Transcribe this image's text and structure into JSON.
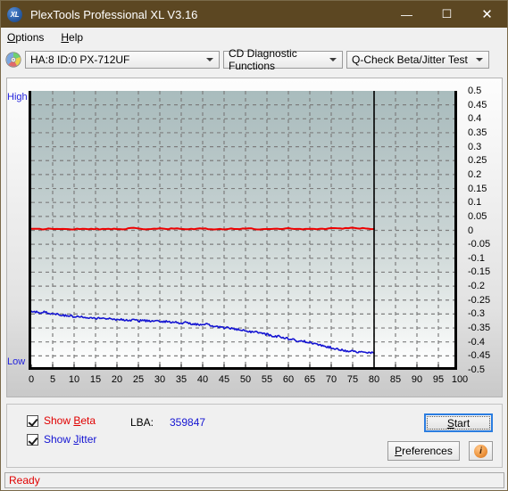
{
  "window": {
    "title": "PlexTools Professional XL V3.16",
    "icon": "app-xl-icon",
    "minimize": "—",
    "maximize": "☐",
    "close": "✕"
  },
  "menubar": {
    "items": [
      {
        "label": "Options",
        "mnemonic": "O"
      },
      {
        "label": "Help",
        "mnemonic": "H"
      }
    ]
  },
  "toolbar": {
    "disc_icon": "disc-icon",
    "drive_select": {
      "value": "HA:8 ID:0  PX-712UF"
    },
    "function_select": {
      "value": "CD Diagnostic Functions"
    },
    "test_select": {
      "value": "Q-Check Beta/Jitter Test"
    }
  },
  "controls": {
    "show_beta": {
      "label": "Show Beta",
      "mnemonic": "B",
      "checked": true,
      "color": "#e00000"
    },
    "show_jitter": {
      "label": "Show Jitter",
      "mnemonic": "J",
      "checked": true,
      "color": "#1414d2"
    },
    "lba_label": "LBA:",
    "lba_value": "359847",
    "start_button": {
      "label": "Start",
      "mnemonic": "S"
    },
    "preferences_button": {
      "label": "Preferences",
      "mnemonic": "P"
    },
    "info_button": {
      "label": "i"
    }
  },
  "statusbar": {
    "text": "Ready"
  },
  "chart_data": {
    "type": "line",
    "title": "Q-Check Beta/Jitter Test",
    "xlabel": "",
    "ylabel": "",
    "grid": true,
    "legend": "none",
    "xlim": [
      0,
      100
    ],
    "ylim": [
      -0.5,
      0.5
    ],
    "x_ticks": [
      0,
      5,
      10,
      15,
      20,
      25,
      30,
      35,
      40,
      45,
      50,
      55,
      60,
      65,
      70,
      75,
      80,
      85,
      90,
      95,
      100
    ],
    "y_ticks": [
      0.5,
      0.45,
      0.4,
      0.35,
      0.3,
      0.25,
      0.2,
      0.15,
      0.1,
      0.05,
      0,
      -0.05,
      -0.1,
      -0.15,
      -0.2,
      -0.25,
      -0.3,
      -0.35,
      -0.4,
      -0.45,
      -0.5
    ],
    "left_axis_labels": {
      "top": "High",
      "bottom": "Low"
    },
    "data_end_marker_x": 80,
    "series": [
      {
        "name": "Beta",
        "color": "#ee0000",
        "x": [
          0,
          2,
          4,
          6,
          8,
          10,
          12,
          14,
          16,
          18,
          20,
          22,
          24,
          26,
          28,
          30,
          32,
          34,
          36,
          38,
          40,
          42,
          44,
          46,
          48,
          50,
          52,
          54,
          56,
          58,
          60,
          62,
          64,
          66,
          68,
          70,
          72,
          74,
          76,
          78,
          80
        ],
        "values": [
          0.005,
          0.004,
          0.006,
          0.005,
          0.004,
          0.005,
          0.005,
          0.006,
          0.004,
          0.005,
          0.006,
          0.005,
          0.008,
          0.004,
          0.005,
          0.006,
          0.005,
          0.007,
          0.004,
          0.005,
          0.006,
          0.005,
          0.004,
          0.006,
          0.005,
          0.007,
          0.005,
          0.004,
          0.006,
          0.005,
          0.008,
          0.005,
          0.004,
          0.006,
          0.005,
          0.007,
          0.006,
          0.009,
          0.008,
          0.007,
          0.005
        ]
      },
      {
        "name": "Jitter",
        "color": "#1414d2",
        "x": [
          0,
          1,
          2,
          3,
          4,
          5,
          6,
          7,
          8,
          9,
          10,
          11,
          12,
          13,
          14,
          15,
          16,
          17,
          18,
          19,
          20,
          21,
          22,
          23,
          24,
          25,
          26,
          27,
          28,
          29,
          30,
          31,
          32,
          33,
          34,
          35,
          36,
          37,
          38,
          39,
          40,
          41,
          42,
          43,
          44,
          45,
          46,
          47,
          48,
          49,
          50,
          51,
          52,
          53,
          54,
          55,
          56,
          57,
          58,
          59,
          60,
          61,
          62,
          63,
          64,
          65,
          66,
          67,
          68,
          69,
          70,
          71,
          72,
          73,
          74,
          75,
          76,
          77,
          78,
          79,
          80
        ],
        "values": [
          -0.288,
          -0.292,
          -0.296,
          -0.291,
          -0.299,
          -0.297,
          -0.301,
          -0.303,
          -0.305,
          -0.306,
          -0.309,
          -0.31,
          -0.309,
          -0.313,
          -0.311,
          -0.315,
          -0.314,
          -0.316,
          -0.317,
          -0.318,
          -0.319,
          -0.32,
          -0.321,
          -0.323,
          -0.32,
          -0.325,
          -0.323,
          -0.324,
          -0.325,
          -0.326,
          -0.327,
          -0.326,
          -0.328,
          -0.329,
          -0.33,
          -0.332,
          -0.331,
          -0.334,
          -0.336,
          -0.338,
          -0.34,
          -0.337,
          -0.342,
          -0.344,
          -0.347,
          -0.35,
          -0.348,
          -0.353,
          -0.356,
          -0.358,
          -0.361,
          -0.364,
          -0.362,
          -0.367,
          -0.37,
          -0.373,
          -0.377,
          -0.381,
          -0.379,
          -0.385,
          -0.388,
          -0.392,
          -0.396,
          -0.394,
          -0.4,
          -0.403,
          -0.407,
          -0.41,
          -0.414,
          -0.417,
          -0.42,
          -0.424,
          -0.428,
          -0.43,
          -0.433,
          -0.431,
          -0.436,
          -0.438,
          -0.437,
          -0.439,
          -0.44
        ]
      }
    ]
  }
}
